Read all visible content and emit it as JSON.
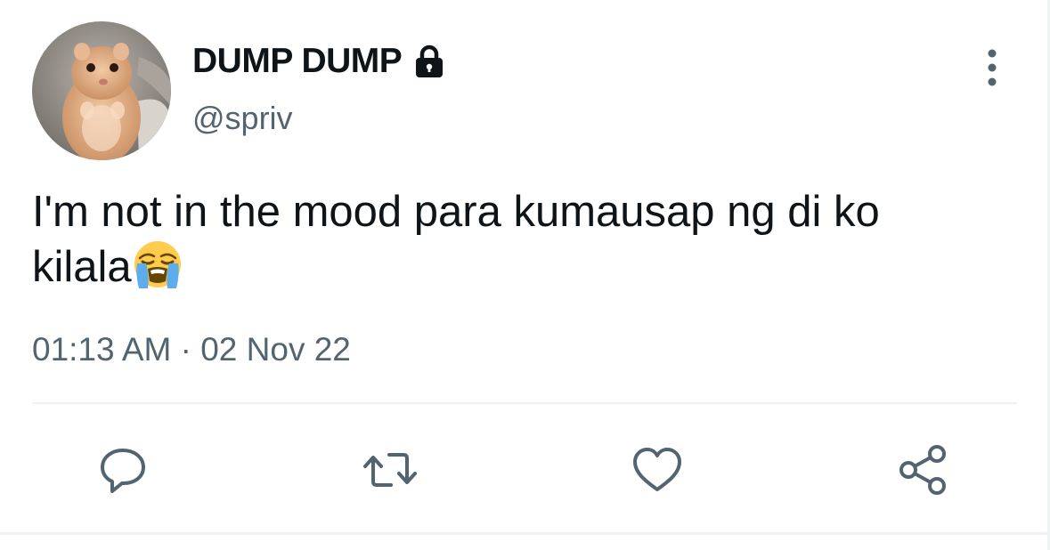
{
  "author": {
    "display_name": "DUMP DUMP",
    "handle": "@spriv",
    "avatar_icon": "hamster-avatar",
    "protected_icon": "lock-icon"
  },
  "header": {
    "more_icon": "more-vertical-icon"
  },
  "tweet": {
    "text_line1": "I'm not in the mood para kumausap ng di ko",
    "text_line2": "kilala",
    "emoji": "loudly-crying-face-emoji",
    "timestamp": "01:13 AM · 02 Nov 22"
  },
  "actions": [
    {
      "name": "reply",
      "icon": "reply-icon"
    },
    {
      "name": "retweet",
      "icon": "retweet-icon"
    },
    {
      "name": "like",
      "icon": "heart-icon"
    },
    {
      "name": "share",
      "icon": "share-icon"
    }
  ],
  "colors": {
    "text_primary": "#0f1419",
    "text_secondary": "#536471",
    "icon_gray": "#536471",
    "divider": "#eff3f4"
  }
}
